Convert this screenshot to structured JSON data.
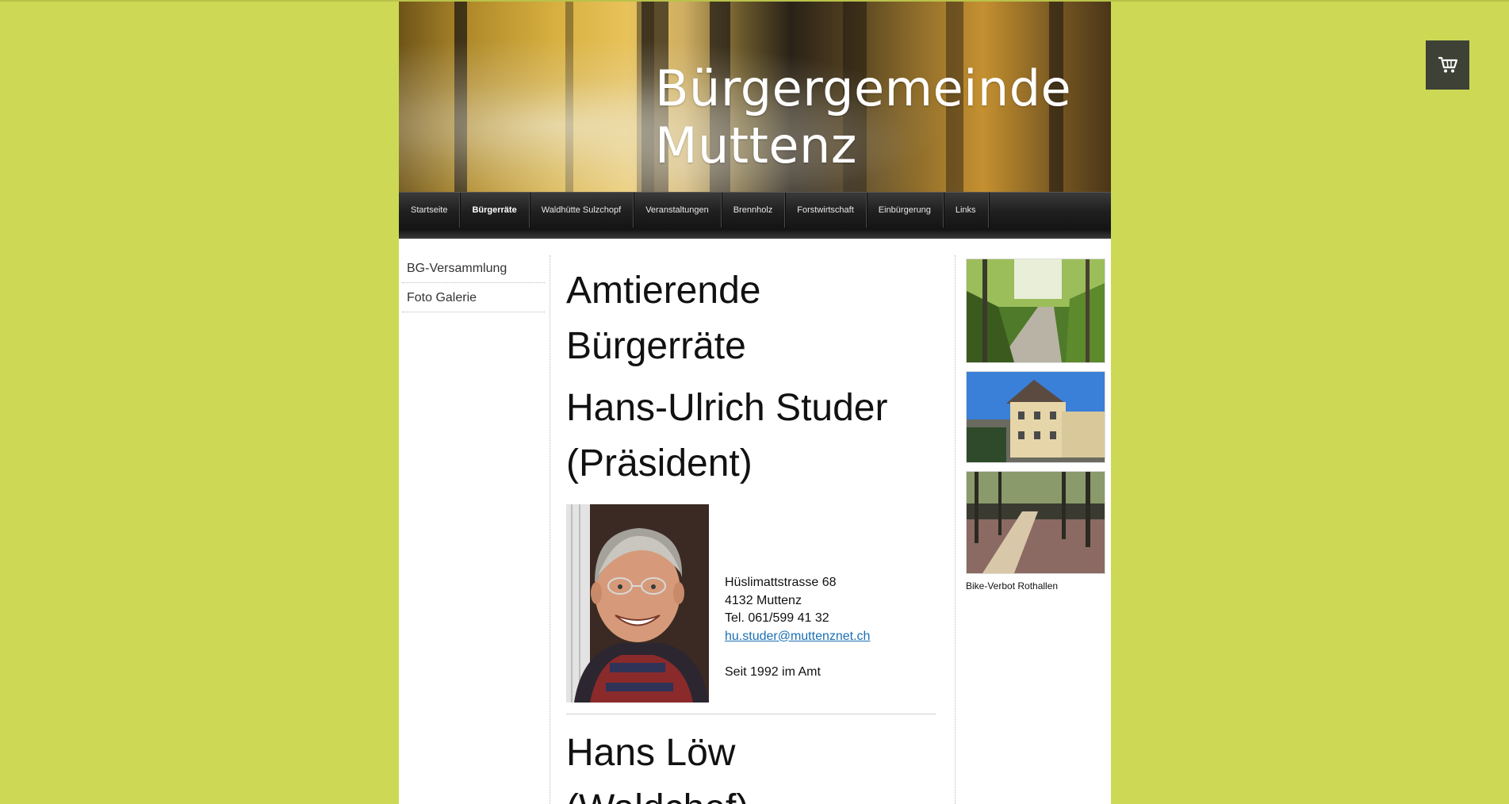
{
  "header": {
    "title_line1": "Bürgergemeinde",
    "title_line2": "Muttenz"
  },
  "nav": {
    "items": [
      {
        "label": "Startseite",
        "active": false
      },
      {
        "label": "Bürgerräte",
        "active": true
      },
      {
        "label": "Waldhütte Sulzchopf",
        "active": false
      },
      {
        "label": "Veranstaltungen",
        "active": false
      },
      {
        "label": "Brennholz",
        "active": false
      },
      {
        "label": "Forstwirtschaft",
        "active": false
      },
      {
        "label": "Einbürgerung",
        "active": false
      },
      {
        "label": "Links",
        "active": false
      }
    ]
  },
  "sidebar": {
    "items": [
      {
        "label": "BG-Versammlung"
      },
      {
        "label": "Foto Galerie"
      }
    ]
  },
  "main": {
    "heading_line1": "Amtierende",
    "heading_line2": "Bürgerräte",
    "person1": {
      "name_line1": "Hans-Ulrich Studer",
      "name_line2": "(Präsident)",
      "address": "Hüslimattstrasse 68",
      "city": "4132 Muttenz",
      "phone": "Tel. 061/599 41 32",
      "email": "hu.studer@muttenznet.ch",
      "since": "Seit 1992 im Amt"
    },
    "person2": {
      "name_line1": "Hans Löw",
      "name_line2": "(Waldchef)"
    }
  },
  "right": {
    "caption": "Bike-Verbot Rothallen"
  },
  "cart": {
    "icon": "cart-icon"
  }
}
